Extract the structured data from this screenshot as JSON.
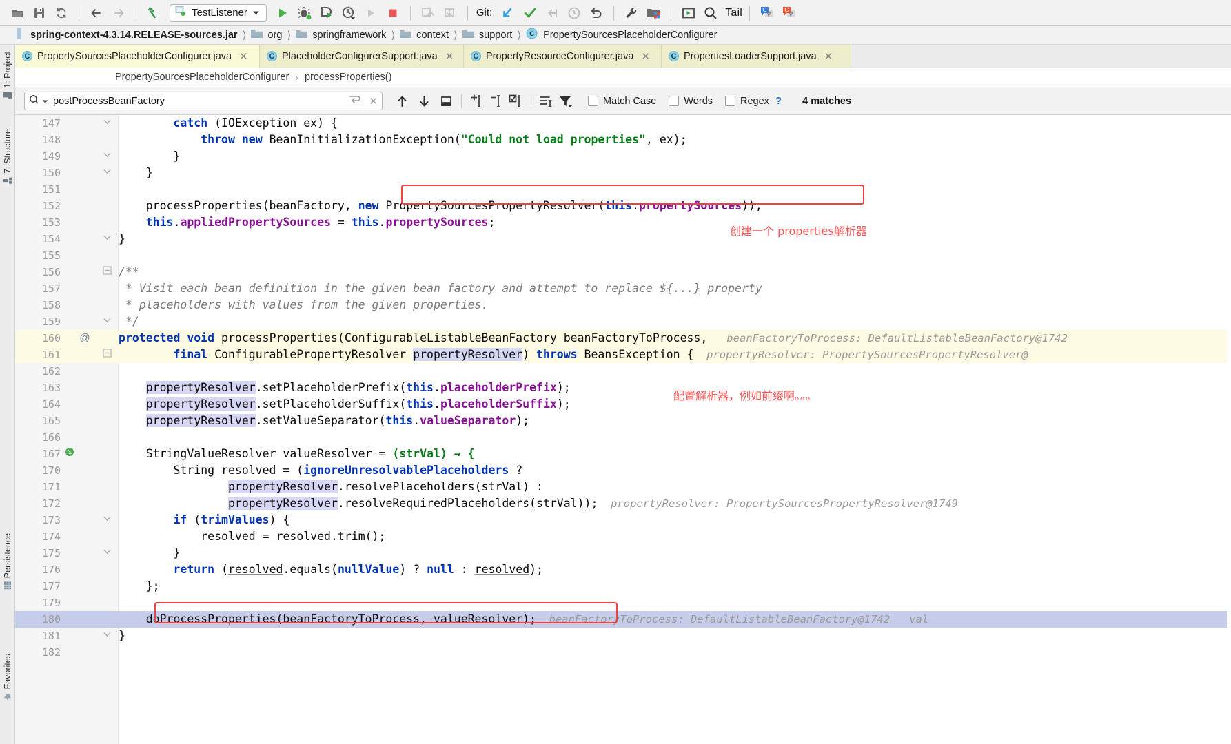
{
  "toolbar": {
    "icons": [
      {
        "name": "open-folder-icon",
        "glyph": "open"
      },
      {
        "name": "save-all-icon",
        "glyph": "save"
      },
      {
        "name": "sync-icon",
        "glyph": "sync"
      },
      {
        "name": "back-icon",
        "glyph": "back"
      },
      {
        "name": "forward-icon",
        "glyph": "forward"
      },
      {
        "name": "build-hammer-icon",
        "glyph": "hammer"
      }
    ],
    "run_config": {
      "label": "TestListener",
      "dropdown": "▼"
    },
    "run_label": "Run",
    "debug_label": "Debug",
    "coverage_label": "Run with Coverage",
    "profile_label": "Profile",
    "stop_label": "Stop",
    "git_label": "Git:",
    "tail_label": "Tail",
    "translate_blue_label": "Translate",
    "translate_red_label": "Translate reverse"
  },
  "navbar": {
    "crumbs": [
      {
        "label": "spring-context-4.3.14.RELEASE-sources.jar",
        "icon": "jar-icon",
        "bold": true
      },
      {
        "label": "org",
        "icon": "folder-icon",
        "bold": false
      },
      {
        "label": "springframework",
        "icon": "folder-icon",
        "bold": false
      },
      {
        "label": "context",
        "icon": "folder-icon",
        "bold": false
      },
      {
        "label": "support",
        "icon": "folder-icon",
        "bold": false
      },
      {
        "label": "PropertySourcesPlaceholderConfigurer",
        "icon": "class-icon",
        "bold": false
      }
    ]
  },
  "left_strip": {
    "items": [
      {
        "label": "1: Project",
        "icon": "project-icon"
      },
      {
        "label": "7: Structure",
        "icon": "structure-icon"
      },
      {
        "label": "Persistence",
        "icon": "persistence-icon"
      },
      {
        "label": "Favorites",
        "icon": "favorites-icon"
      }
    ]
  },
  "tabs": [
    {
      "label": "PropertySourcesPlaceholderConfigurer.java",
      "icon_letter": "C",
      "active": true
    },
    {
      "label": "PlaceholderConfigurerSupport.java",
      "icon_letter": "C",
      "active": false
    },
    {
      "label": "PropertyResourceConfigurer.java",
      "icon_letter": "C",
      "active": false
    },
    {
      "label": "PropertiesLoaderSupport.java",
      "icon_letter": "C",
      "active": false
    }
  ],
  "member_breadcrumb": {
    "class": "PropertySourcesPlaceholderConfigurer",
    "separator": "›",
    "method": "processProperties()"
  },
  "findbar": {
    "query": "postProcessBeanFactory",
    "placeholder": "Search",
    "search_icon": "magnifier-icon",
    "history_icon": "chevron-down-icon",
    "wrap_icon": "wrap-around-icon",
    "clear_icon": "close-icon",
    "prev_label": "Previous Occurrence",
    "next_label": "Next Occurrence",
    "select_all_label": "Select All Occurrences",
    "add_line_label": "Add Line",
    "remove_line_label": "Remove Line",
    "select_lines_label": "Select Lines",
    "preserve_case_label": "Preserve Case",
    "filter_label": "Filter",
    "match_case_label": "Match Case",
    "words_label": "Words",
    "regex_label": "Regex",
    "help_label": "?",
    "matches_label": "4 matches"
  },
  "editor": {
    "lines": [
      {
        "num": "147",
        "gutter": "fold-end",
        "indent": 0,
        "highlight": "none",
        "html": "        <span class=\"kw\">catch</span> (IOException ex) {"
      },
      {
        "num": "148",
        "gutter": "",
        "indent": 0,
        "highlight": "none",
        "html": "            <span class=\"kw\">throw</span> <span class=\"kw\">new</span> BeanInitializationException(<span class=\"str\">\"Could not load properties\"</span>, ex);"
      },
      {
        "num": "149",
        "gutter": "fold-end",
        "indent": 0,
        "highlight": "none",
        "html": "        }"
      },
      {
        "num": "150",
        "gutter": "fold-end",
        "indent": 0,
        "highlight": "none",
        "html": "    }"
      },
      {
        "num": "151",
        "gutter": "",
        "indent": 0,
        "highlight": "none",
        "html": ""
      },
      {
        "num": "152",
        "gutter": "",
        "indent": 0,
        "highlight": "none",
        "html": "    processProperties(beanFactory, <span class=\"kw\">new</span> PropertySourcesPropertyResolver(<span class=\"kw\">this</span>.<span class=\"fld\">propertySources</span>));"
      },
      {
        "num": "153",
        "gutter": "",
        "indent": 0,
        "highlight": "none",
        "html": "    <span class=\"kw\">this</span>.<span class=\"fld\">appliedPropertySources</span> = <span class=\"kw\">this</span>.<span class=\"fld\">propertySources</span>;"
      },
      {
        "num": "154",
        "gutter": "fold-end",
        "indent": 0,
        "highlight": "none",
        "html": "}"
      },
      {
        "num": "155",
        "gutter": "",
        "indent": 0,
        "highlight": "none",
        "html": ""
      },
      {
        "num": "156",
        "gutter": "fold-start",
        "indent": 0,
        "highlight": "none",
        "html": "<span class=\"cmt\">/**</span>"
      },
      {
        "num": "157",
        "gutter": "",
        "indent": 0,
        "highlight": "none",
        "html": "<span class=\"cmt\"> * Visit each bean definition in the given bean factory and attempt to replace ${...} property</span>"
      },
      {
        "num": "158",
        "gutter": "",
        "indent": 0,
        "highlight": "none",
        "html": "<span class=\"cmt\"> * placeholders with values from the given properties.</span>"
      },
      {
        "num": "159",
        "gutter": "fold-end",
        "indent": 0,
        "highlight": "none",
        "html": "<span class=\"cmt\"> */</span>"
      },
      {
        "num": "160",
        "gutter": "override",
        "indent": 0,
        "highlight": "current",
        "html": "<span class=\"kw\">protected</span> <span class=\"kw\">void</span> processProperties(ConfigurableListableBeanFactory beanFactoryToProcess,<span class=\"hint\">   beanFactoryToProcess: DefaultListableBeanFactory@1742</span>"
      },
      {
        "num": "161",
        "gutter": "fold-start",
        "indent": 0,
        "highlight": "current",
        "html": "        <span class=\"kw\">final</span> ConfigurablePropertyResolver <span class=\"varhl\">propertyResolver</span>) <span class=\"kw\">throws</span> BeansException {<span class=\"hint\">  propertyResolver: PropertySourcesPropertyResolver@</span>"
      },
      {
        "num": "162",
        "gutter": "",
        "indent": 0,
        "highlight": "none",
        "html": ""
      },
      {
        "num": "163",
        "gutter": "",
        "indent": 0,
        "highlight": "none",
        "html": "    <span class=\"varhl\">propertyResolver</span>.setPlaceholderPrefix(<span class=\"kw\">this</span>.<span class=\"fld\">placeholderPrefix</span>);"
      },
      {
        "num": "164",
        "gutter": "",
        "indent": 0,
        "highlight": "none",
        "html": "    <span class=\"varhl\">propertyResolver</span>.setPlaceholderSuffix(<span class=\"kw\">this</span>.<span class=\"fld\">placeholderSuffix</span>);"
      },
      {
        "num": "165",
        "gutter": "",
        "indent": 0,
        "highlight": "none",
        "html": "    <span class=\"varhl\">propertyResolver</span>.setValueSeparator(<span class=\"kw\">this</span>.<span class=\"fld\">valueSeparator</span>);"
      },
      {
        "num": "166",
        "gutter": "",
        "indent": 0,
        "highlight": "none",
        "html": ""
      },
      {
        "num": "167",
        "gutter": "lambda",
        "indent": 0,
        "highlight": "none",
        "html": "    StringValueResolver valueResolver = <span class=\"lam\">(strVal) → {</span>"
      },
      {
        "num": "170",
        "gutter": "",
        "indent": 0,
        "highlight": "none",
        "html": "        String <span class=\"undl\">resolved</span> = (<span class=\"kw\">ignoreUnresolvablePlaceholders</span> ?"
      },
      {
        "num": "171",
        "gutter": "",
        "indent": 0,
        "highlight": "none",
        "html": "                <span class=\"varhl\">propertyResolver</span>.resolvePlaceholders(strVal) :"
      },
      {
        "num": "172",
        "gutter": "",
        "indent": 0,
        "highlight": "none",
        "html": "                <span class=\"varhl\">propertyResolver</span>.resolveRequiredPlaceholders(strVal));<span class=\"hint\">  propertyResolver: PropertySourcesPropertyResolver@1749</span>"
      },
      {
        "num": "173",
        "gutter": "fold-end",
        "indent": 0,
        "highlight": "none",
        "html": "        <span class=\"kw\">if</span> (<span class=\"kw\">trimValues</span>) {"
      },
      {
        "num": "174",
        "gutter": "",
        "indent": 0,
        "highlight": "none",
        "html": "            <span class=\"undl\">resolved</span> = <span class=\"undl\">resolved</span>.trim();"
      },
      {
        "num": "175",
        "gutter": "fold-end",
        "indent": 0,
        "highlight": "none",
        "html": "        }"
      },
      {
        "num": "176",
        "gutter": "",
        "indent": 0,
        "highlight": "none",
        "html": "        <span class=\"kw\">return</span> (<span class=\"undl\">resolved</span>.equals(<span class=\"kw\">nullValue</span>) ? <span class=\"kw\">null</span> : <span class=\"undl\">resolved</span>);"
      },
      {
        "num": "177",
        "gutter": "",
        "indent": 0,
        "highlight": "none",
        "html": "    };"
      },
      {
        "num": "179",
        "gutter": "",
        "indent": 0,
        "highlight": "none",
        "html": ""
      },
      {
        "num": "180",
        "gutter": "",
        "indent": 0,
        "highlight": "select",
        "html": "    doProcessProperties(beanFactoryToProcess, valueResolver);<span class=\"hint\">  beanFactoryToProcess: DefaultListableBeanFactory@1742   val</span>"
      },
      {
        "num": "181",
        "gutter": "fold-end",
        "indent": 0,
        "highlight": "none",
        "html": "}"
      },
      {
        "num": "182",
        "gutter": "",
        "indent": 0,
        "highlight": "none",
        "html": ""
      }
    ]
  },
  "annotations": {
    "note1": "创建一个 properties解析器",
    "note2": "配置解析器，例如前缀啊。。。"
  },
  "colors": {
    "accent_blue": "#3f7fd0",
    "annotation_red": "#fb5555",
    "box_red": "#f04040",
    "keyword_blue": "#0033b3",
    "field_purple": "#871094",
    "string_green": "#067d17",
    "tab_active": "#fafad7",
    "selection": "#c5cdeb",
    "current_line": "#fdfbe4"
  }
}
